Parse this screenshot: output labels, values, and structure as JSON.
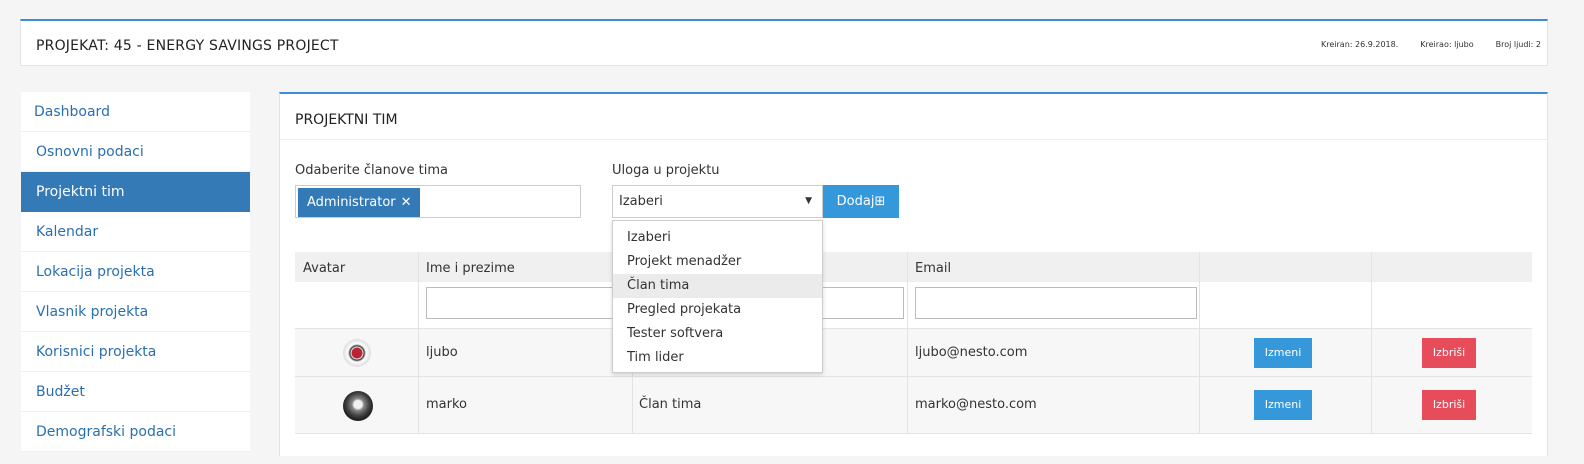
{
  "header": {
    "title": "PROJEKAT: 45 - ENERGY SAVINGS PROJECT",
    "created": "Kreiran: 26.9.2018.",
    "creator": "Kreirao: ljubo",
    "people_count": "Broj ljudi: 2"
  },
  "sidebar": {
    "items": [
      {
        "label": "Dashboard"
      },
      {
        "label": "Osnovni podaci"
      },
      {
        "label": "Projektni tim"
      },
      {
        "label": "Kalendar"
      },
      {
        "label": "Lokacija projekta"
      },
      {
        "label": "Vlasnik projekta"
      },
      {
        "label": "Korisnici projekta"
      },
      {
        "label": "Budžet"
      },
      {
        "label": "Demografski podaci"
      }
    ],
    "active_index": 2
  },
  "panel": {
    "title": "PROJEKTNI TIM",
    "members_label": "Odaberite članove tima",
    "selected_tag": "Administrator",
    "tag_remove": "✕",
    "role_label": "Uloga u projektu",
    "role_value": "Izaberi",
    "add_button": "Dodaj",
    "add_icon": "⊞"
  },
  "table": {
    "headers": [
      "Avatar",
      "Ime i prezime",
      "",
      "Email",
      "",
      ""
    ],
    "rows": [
      {
        "name": "ljubo",
        "role": "",
        "email": "ljubo@nesto.com",
        "edit": "Izmeni",
        "delete": "Izbriši"
      },
      {
        "name": "marko",
        "role": "Član tima",
        "email": "marko@nesto.com",
        "edit": "Izmeni",
        "delete": "Izbriši"
      }
    ]
  },
  "dropdown": {
    "options": [
      "Izaberi",
      "Projekt menadžer",
      "Član tima",
      "Pregled projekata",
      "Tester softvera",
      "Tim lider"
    ],
    "highlighted_index": 2
  },
  "colors": {
    "accent": "#337ab7",
    "button_blue": "#3498db",
    "button_red": "#e74c5b"
  }
}
